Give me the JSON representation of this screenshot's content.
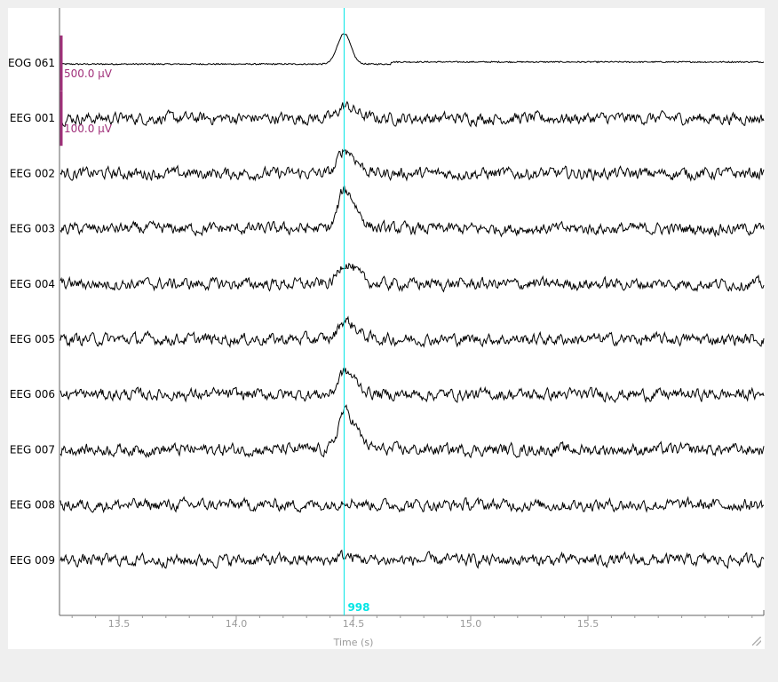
{
  "chart_data": {
    "type": "line",
    "title": "",
    "xlabel": "Time (s)",
    "ylabel": "",
    "xlim": [
      13.25,
      16.25
    ],
    "x_ticks": [
      "13.5",
      "14.0",
      "14.5",
      "15.0",
      "15.5"
    ],
    "x_tick_values": [
      13.5,
      14.0,
      14.5,
      15.0,
      15.5
    ],
    "channels": [
      "EOG 061",
      "EEG 001",
      "EEG 002",
      "EEG 003",
      "EEG 004",
      "EEG 005",
      "EEG 006",
      "EEG 007",
      "EEG 008",
      "EEG 009"
    ],
    "scale_bars": [
      {
        "label": "500.0 µV",
        "channel": "EOG 061"
      },
      {
        "label": "100.0 µV",
        "channel": "EEG 001"
      }
    ],
    "events": [
      {
        "label": "998",
        "time": 14.46,
        "color": "#00e5e5"
      }
    ],
    "series": [
      {
        "name": "EOG 061",
        "baseline": -0.04,
        "peak_amplitude": 1.15,
        "peak_time": 14.46,
        "post_level": 0.04
      },
      {
        "name": "EEG 001",
        "peak_amplitude": 0.45,
        "peak_time": 14.46
      },
      {
        "name": "EEG 002",
        "peak_amplitude": 0.9,
        "peak_time": 14.46
      },
      {
        "name": "EEG 003",
        "peak_amplitude": 1.45,
        "peak_time": 14.46
      },
      {
        "name": "EEG 004",
        "peak_amplitude": 0.8,
        "peak_time": 14.46
      },
      {
        "name": "EEG 005",
        "peak_amplitude": 0.7,
        "peak_time": 14.46
      },
      {
        "name": "EEG 006",
        "peak_amplitude": 0.85,
        "peak_time": 14.46
      },
      {
        "name": "EEG 007",
        "peak_amplitude": 1.45,
        "peak_time": 14.46
      },
      {
        "name": "EEG 008",
        "peak_amplitude": 0.18,
        "peak_time": 14.46
      },
      {
        "name": "EEG 009",
        "peak_amplitude": 0.15,
        "peak_time": 14.46
      }
    ],
    "colors": {
      "trace": "#000000",
      "event": "#00e5e5",
      "scale": "#a0307a",
      "axis": "#9a9a9a"
    }
  }
}
